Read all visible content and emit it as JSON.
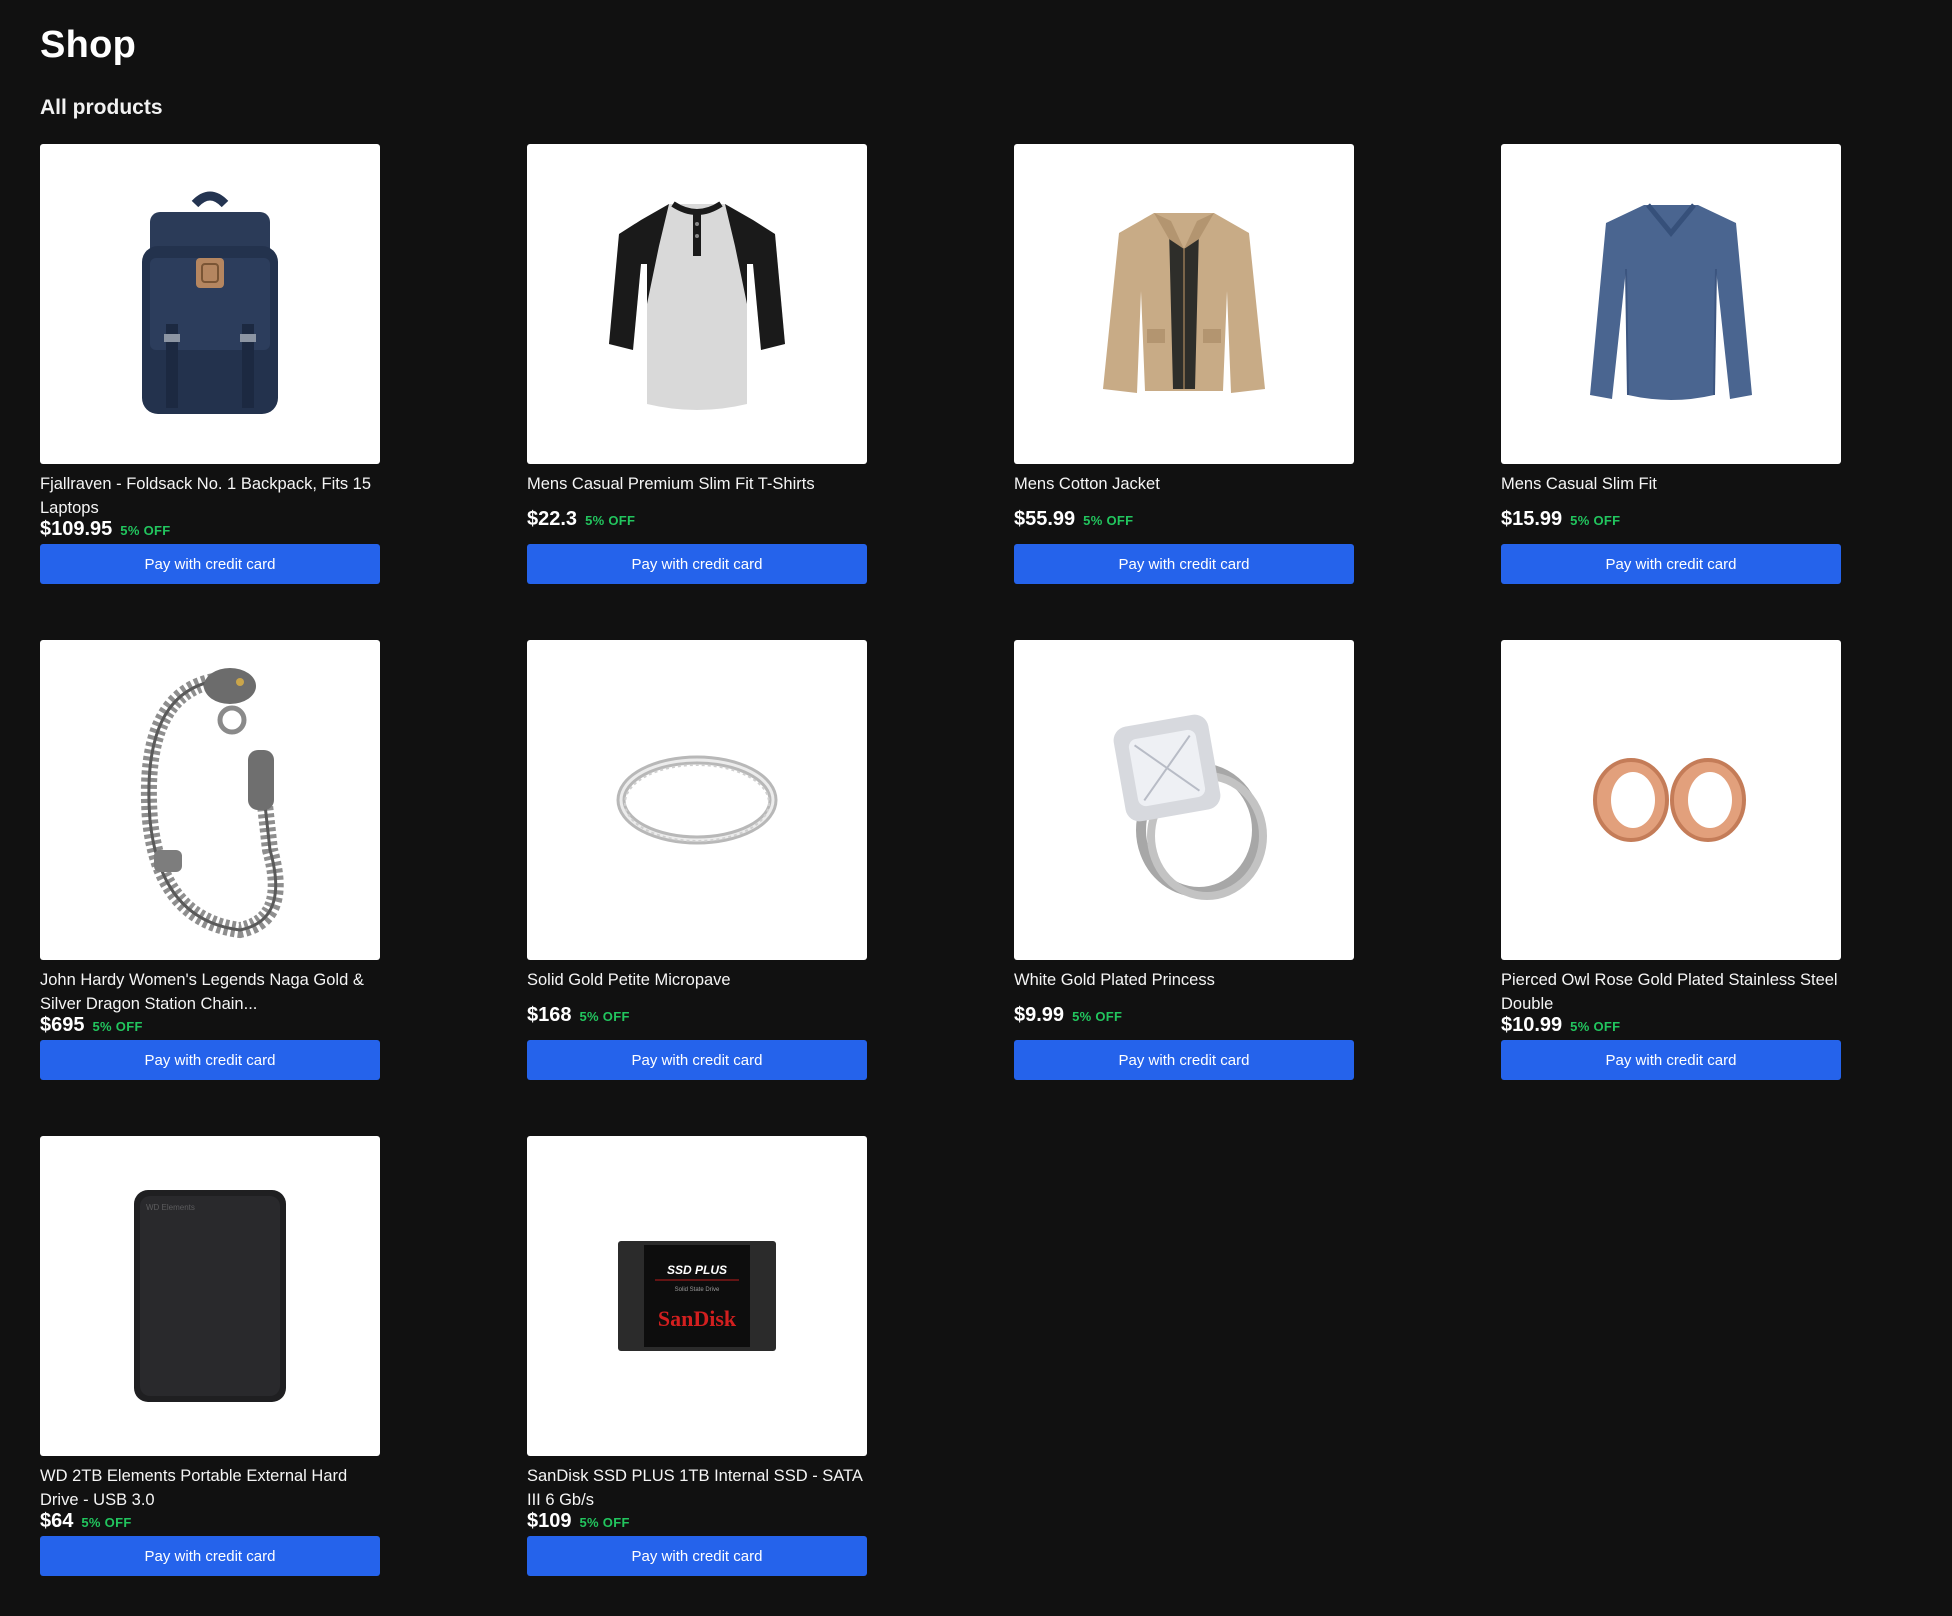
{
  "header": {
    "title": "Shop",
    "section_label": "All products"
  },
  "colors": {
    "background": "#111111",
    "button": "#2563eb",
    "discount": "#22c55e",
    "card": "#ffffff"
  },
  "products": [
    {
      "name": "Fjallraven - Foldsack No. 1 Backpack, Fits 15 Laptops",
      "price": "$109.95",
      "discount": "5% OFF",
      "button_label": "Pay with credit card",
      "image_icon": "backpack-icon"
    },
    {
      "name": "Mens Casual Premium Slim Fit T-Shirts",
      "price": "$22.3",
      "discount": "5% OFF",
      "button_label": "Pay with credit card",
      "image_icon": "tshirt-icon"
    },
    {
      "name": "Mens Cotton Jacket",
      "price": "$55.99",
      "discount": "5% OFF",
      "button_label": "Pay with credit card",
      "image_icon": "jacket-icon"
    },
    {
      "name": "Mens Casual Slim Fit",
      "price": "$15.99",
      "discount": "5% OFF",
      "button_label": "Pay with credit card",
      "image_icon": "sweater-icon"
    },
    {
      "name": "John Hardy Women's Legends Naga Gold & Silver Dragon Station Chain...",
      "price": "$695",
      "discount": "5% OFF",
      "button_label": "Pay with credit card",
      "image_icon": "bracelet-icon"
    },
    {
      "name": "Solid Gold Petite Micropave",
      "price": "$168",
      "discount": "5% OFF",
      "button_label": "Pay with credit card",
      "image_icon": "ring-icon"
    },
    {
      "name": "White Gold Plated Princess",
      "price": "$9.99",
      "discount": "5% OFF",
      "button_label": "Pay with credit card",
      "image_icon": "diamond-ring-icon"
    },
    {
      "name": "Pierced Owl Rose Gold Plated Stainless Steel Double",
      "price": "$10.99",
      "discount": "5% OFF",
      "button_label": "Pay with credit card",
      "image_icon": "ear-tunnels-icon"
    },
    {
      "name": "WD 2TB Elements Portable External Hard Drive - USB 3.0",
      "price": "$64",
      "discount": "5% OFF",
      "button_label": "Pay with credit card",
      "image_icon": "hard-drive-icon",
      "image_brand_text": "WD Elements"
    },
    {
      "name": "SanDisk SSD PLUS 1TB Internal SSD - SATA III 6 Gb/s",
      "price": "$109",
      "discount": "5% OFF",
      "button_label": "Pay with credit card",
      "image_icon": "ssd-icon",
      "image_brand_text": "SSD PLUS",
      "image_brand_sub": "Solid State Drive",
      "image_brand_logo": "SanDisk"
    }
  ]
}
